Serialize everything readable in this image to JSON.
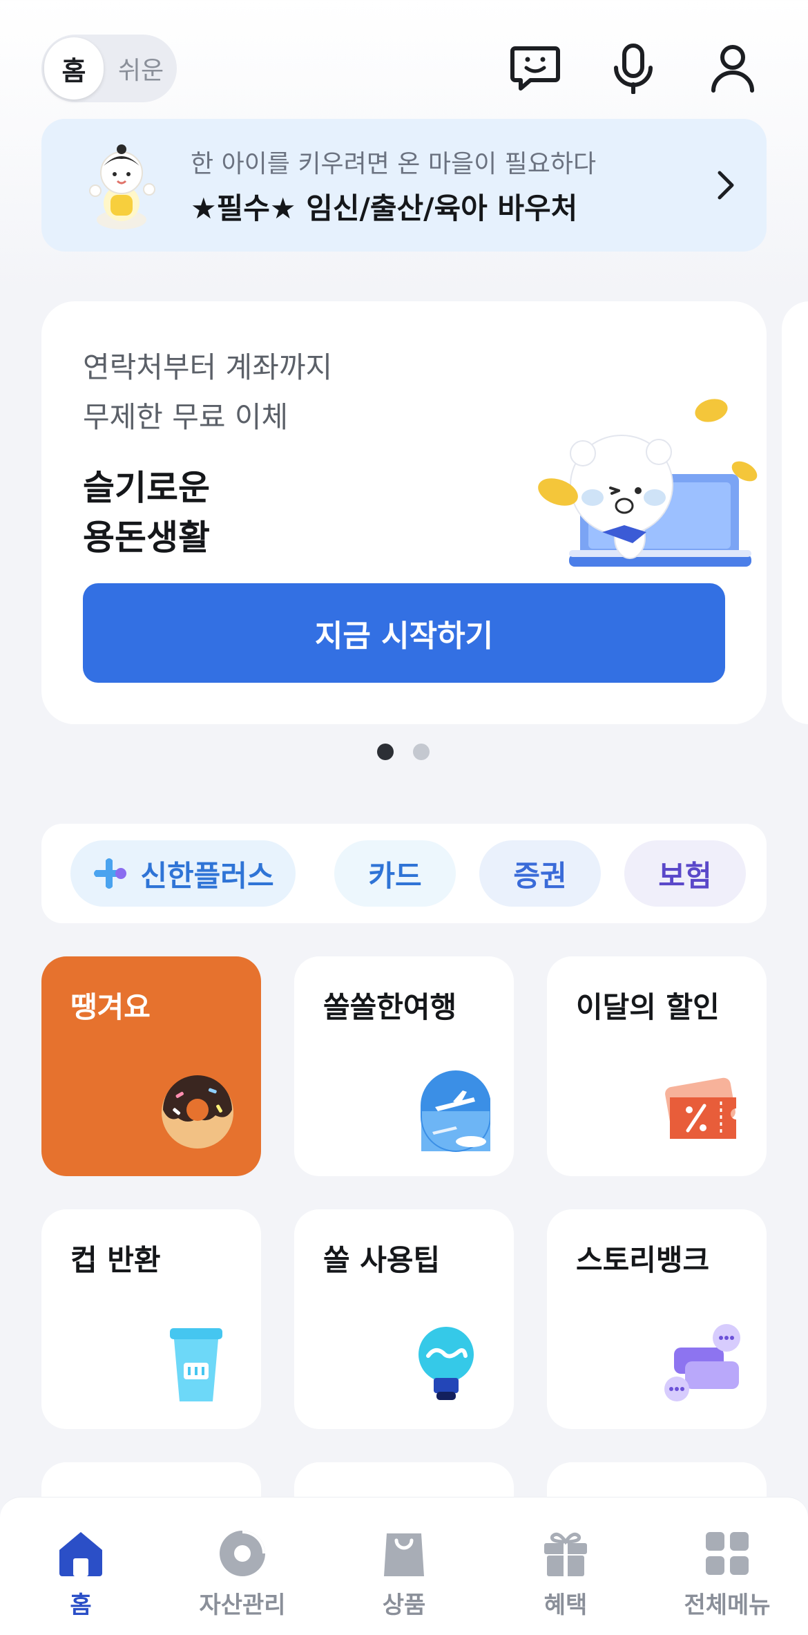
{
  "header": {
    "mode_active": "홈",
    "mode_alt": "쉬운",
    "icons": [
      "chatbot-icon",
      "microphone-icon",
      "profile-icon"
    ]
  },
  "banner": {
    "subtitle": "한 아이를 키우려면 온 마을이 필요하다",
    "title": "★필수★ 임신/출산/육아 바우처"
  },
  "promo": {
    "subtitle_line1": "연락처부터 계좌까지",
    "subtitle_line2": "무제한 무료 이체",
    "title_line1": "슬기로운",
    "title_line2": "용돈생활",
    "button_label": "지금 시작하기",
    "page_count": 2,
    "current_page": 1
  },
  "chips": [
    {
      "label": "신한플러스",
      "icon": "shinhan-plus-icon"
    },
    {
      "label": "카드"
    },
    {
      "label": "증권"
    },
    {
      "label": "보험"
    }
  ],
  "tiles": [
    {
      "label": "땡겨요",
      "icon": "donut-icon"
    },
    {
      "label": "쏠쏠한여행",
      "icon": "airplane-window-icon"
    },
    {
      "label": "이달의 할인",
      "icon": "coupon-icon"
    },
    {
      "label": "컵 반환",
      "icon": "cup-icon"
    },
    {
      "label": "쏠 사용팁",
      "icon": "lightbulb-icon"
    },
    {
      "label": "스토리뱅크",
      "icon": "chat-bubbles-icon"
    }
  ],
  "bottom_nav": [
    {
      "label": "홈",
      "icon": "home-icon",
      "active": true
    },
    {
      "label": "자산관리",
      "icon": "pie-chart-icon",
      "active": false
    },
    {
      "label": "상품",
      "icon": "shopping-bag-icon",
      "active": false
    },
    {
      "label": "혜택",
      "icon": "gift-icon",
      "active": false
    },
    {
      "label": "전체메뉴",
      "icon": "grid-menu-icon",
      "active": false
    }
  ],
  "colors": {
    "accent": "#3370e3",
    "nav_active": "#2b4fc7",
    "tile_highlight": "#e6722e",
    "banner_bg": "#e6f1fd"
  }
}
